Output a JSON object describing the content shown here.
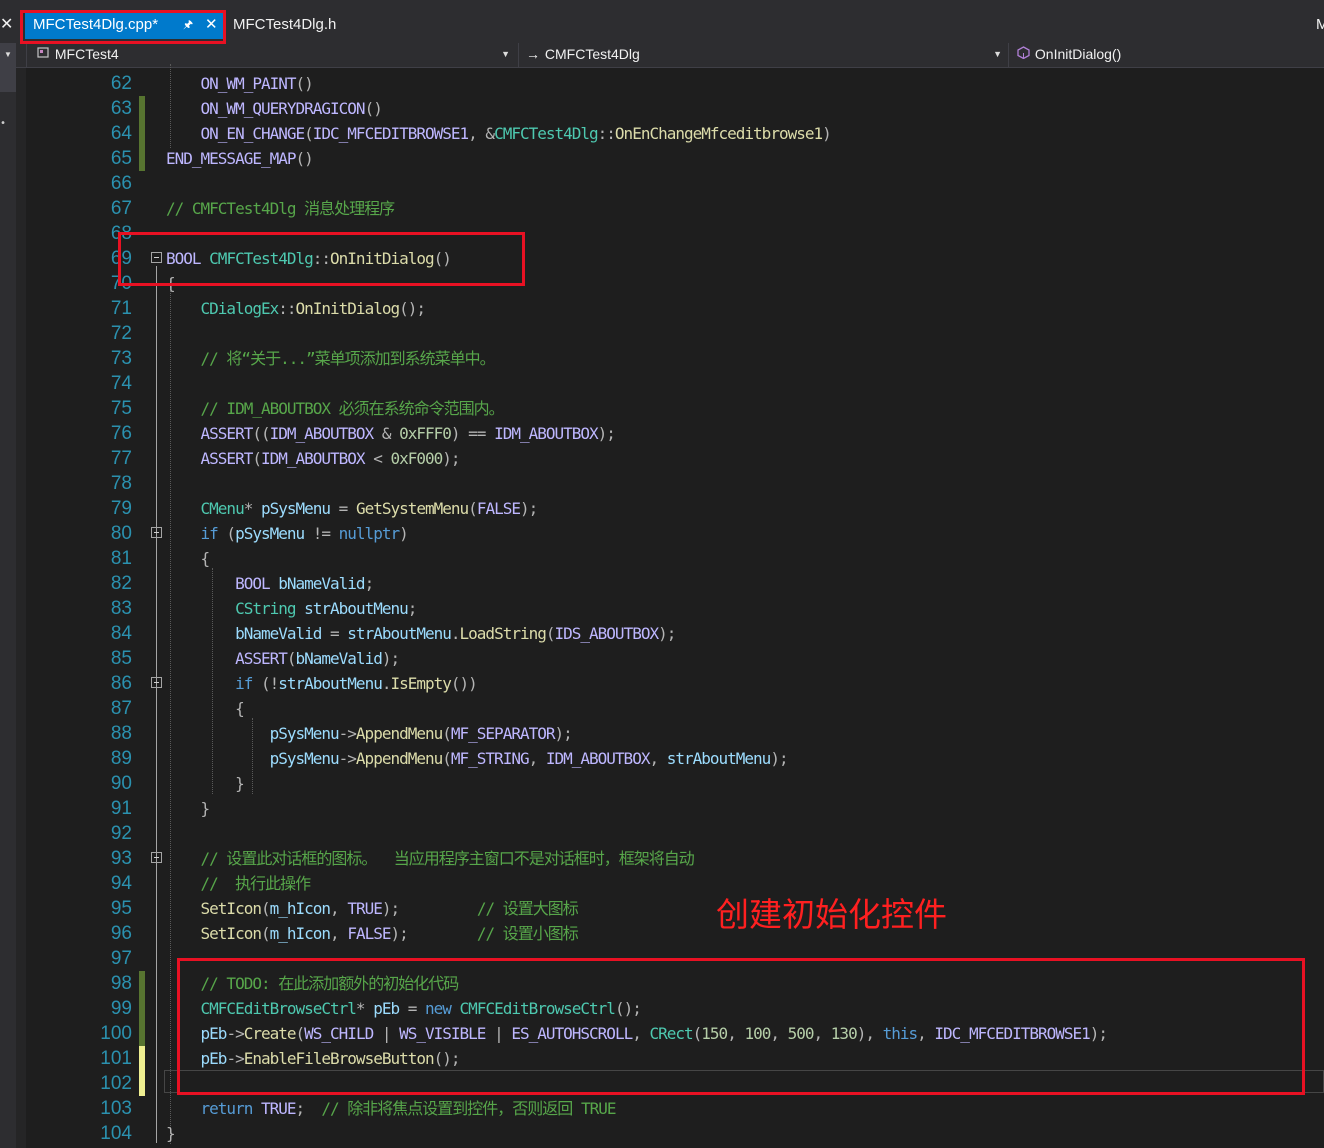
{
  "tabs": {
    "active": {
      "label": "MFCTest4Dlg.cpp*",
      "pin": "🖈",
      "close": "✕"
    },
    "inactive": {
      "label": "MFCTest4Dlg.h"
    },
    "overflow": "M",
    "strip_close": "✕"
  },
  "navbar": {
    "project": "MFCTest4",
    "class": "CMFCTest4Dlg",
    "member": "OnInitDialog()",
    "dropdown_arrow": "▼"
  },
  "icons": {
    "project": "project-icon",
    "class_arrow": "→",
    "method": "method-cube-icon"
  },
  "annotation": "创建初始化控件",
  "colors": {
    "accent": "#007acc",
    "highlight_box": "#e81123",
    "annotation": "#ff2020",
    "line_number": "#2b91af",
    "saved_change": "#577430",
    "unsaved_change": "#efef91"
  },
  "code_lines": [
    {
      "n": "62",
      "toks": [
        [
          "    ",
          "t"
        ],
        [
          "ON_WM_PAINT",
          "m"
        ],
        [
          "()",
          "p"
        ]
      ]
    },
    {
      "n": "63",
      "toks": [
        [
          "    ",
          "t"
        ],
        [
          "ON_WM_QUERYDRAGICON",
          "m"
        ],
        [
          "()",
          "p"
        ]
      ]
    },
    {
      "n": "64",
      "toks": [
        [
          "    ",
          "t"
        ],
        [
          "ON_EN_CHANGE",
          "m"
        ],
        [
          "(",
          "p"
        ],
        [
          "IDC_MFCEDITBROWSE1",
          "m"
        ],
        [
          ", &",
          "p"
        ],
        [
          "CMFCTest4Dlg",
          "y"
        ],
        [
          "::",
          "p"
        ],
        [
          "OnEnChangeMfceditbrowse1",
          "f"
        ],
        [
          ")",
          "p"
        ]
      ]
    },
    {
      "n": "65",
      "toks": [
        [
          "END_MESSAGE_MAP",
          "m"
        ],
        [
          "()",
          "p"
        ]
      ]
    },
    {
      "n": "66",
      "toks": []
    },
    {
      "n": "67",
      "toks": [
        [
          "// CMFCTest4Dlg 消息处理程序",
          "c"
        ]
      ]
    },
    {
      "n": "68",
      "toks": []
    },
    {
      "n": "69",
      "toks": [
        [
          "BOOL",
          "m"
        ],
        [
          " ",
          "t"
        ],
        [
          "CMFCTest4Dlg",
          "y"
        ],
        [
          "::",
          "p"
        ],
        [
          "OnInitDialog",
          "f"
        ],
        [
          "()",
          "p"
        ]
      ]
    },
    {
      "n": "70",
      "toks": [
        [
          "{",
          "p"
        ]
      ]
    },
    {
      "n": "71",
      "toks": [
        [
          "    ",
          "t"
        ],
        [
          "CDialogEx",
          "y"
        ],
        [
          "::",
          "p"
        ],
        [
          "OnInitDialog",
          "f"
        ],
        [
          "();",
          "p"
        ]
      ]
    },
    {
      "n": "72",
      "toks": []
    },
    {
      "n": "73",
      "toks": [
        [
          "    ",
          "t"
        ],
        [
          "// 将“关于...”菜单项添加到系统菜单中。",
          "c"
        ]
      ]
    },
    {
      "n": "74",
      "toks": []
    },
    {
      "n": "75",
      "toks": [
        [
          "    ",
          "t"
        ],
        [
          "// IDM_ABOUTBOX 必须在系统命令范围内。",
          "c"
        ]
      ]
    },
    {
      "n": "76",
      "toks": [
        [
          "    ",
          "t"
        ],
        [
          "ASSERT",
          "m"
        ],
        [
          "((",
          "p"
        ],
        [
          "IDM_ABOUTBOX",
          "m"
        ],
        [
          " & ",
          "p"
        ],
        [
          "0xFFF0",
          "n"
        ],
        [
          ") == ",
          "p"
        ],
        [
          "IDM_ABOUTBOX",
          "m"
        ],
        [
          ");",
          "p"
        ]
      ]
    },
    {
      "n": "77",
      "toks": [
        [
          "    ",
          "t"
        ],
        [
          "ASSERT",
          "m"
        ],
        [
          "(",
          "p"
        ],
        [
          "IDM_ABOUTBOX",
          "m"
        ],
        [
          " < ",
          "p"
        ],
        [
          "0xF000",
          "n"
        ],
        [
          ");",
          "p"
        ]
      ]
    },
    {
      "n": "78",
      "toks": []
    },
    {
      "n": "79",
      "toks": [
        [
          "    ",
          "t"
        ],
        [
          "CMenu",
          "y"
        ],
        [
          "* ",
          "p"
        ],
        [
          "pSysMenu",
          "v"
        ],
        [
          " = ",
          "p"
        ],
        [
          "GetSystemMenu",
          "f"
        ],
        [
          "(",
          "p"
        ],
        [
          "FALSE",
          "m"
        ],
        [
          ");",
          "p"
        ]
      ]
    },
    {
      "n": "80",
      "toks": [
        [
          "    ",
          "t"
        ],
        [
          "if",
          "k"
        ],
        [
          " (",
          "p"
        ],
        [
          "pSysMenu",
          "v"
        ],
        [
          " != ",
          "p"
        ],
        [
          "nullptr",
          "k"
        ],
        [
          ")",
          "p"
        ]
      ]
    },
    {
      "n": "81",
      "toks": [
        [
          "    ",
          "t"
        ],
        [
          "{",
          "p"
        ]
      ]
    },
    {
      "n": "82",
      "toks": [
        [
          "        ",
          "t"
        ],
        [
          "BOOL",
          "m"
        ],
        [
          " ",
          "t"
        ],
        [
          "bNameValid",
          "v"
        ],
        [
          ";",
          "p"
        ]
      ]
    },
    {
      "n": "83",
      "toks": [
        [
          "        ",
          "t"
        ],
        [
          "CString",
          "y"
        ],
        [
          " ",
          "t"
        ],
        [
          "strAboutMenu",
          "v"
        ],
        [
          ";",
          "p"
        ]
      ]
    },
    {
      "n": "84",
      "toks": [
        [
          "        ",
          "t"
        ],
        [
          "bNameValid",
          "v"
        ],
        [
          " = ",
          "p"
        ],
        [
          "strAboutMenu",
          "v"
        ],
        [
          ".",
          "p"
        ],
        [
          "LoadString",
          "f"
        ],
        [
          "(",
          "p"
        ],
        [
          "IDS_ABOUTBOX",
          "m"
        ],
        [
          ");",
          "p"
        ]
      ]
    },
    {
      "n": "85",
      "toks": [
        [
          "        ",
          "t"
        ],
        [
          "ASSERT",
          "m"
        ],
        [
          "(",
          "p"
        ],
        [
          "bNameValid",
          "v"
        ],
        [
          ");",
          "p"
        ]
      ]
    },
    {
      "n": "86",
      "toks": [
        [
          "        ",
          "t"
        ],
        [
          "if",
          "k"
        ],
        [
          " (!",
          "p"
        ],
        [
          "strAboutMenu",
          "v"
        ],
        [
          ".",
          "p"
        ],
        [
          "IsEmpty",
          "f"
        ],
        [
          "())",
          "p"
        ]
      ]
    },
    {
      "n": "87",
      "toks": [
        [
          "        ",
          "t"
        ],
        [
          "{",
          "p"
        ]
      ]
    },
    {
      "n": "88",
      "toks": [
        [
          "            ",
          "t"
        ],
        [
          "pSysMenu",
          "v"
        ],
        [
          "->",
          "p"
        ],
        [
          "AppendMenu",
          "f"
        ],
        [
          "(",
          "p"
        ],
        [
          "MF_SEPARATOR",
          "m"
        ],
        [
          ");",
          "p"
        ]
      ]
    },
    {
      "n": "89",
      "toks": [
        [
          "            ",
          "t"
        ],
        [
          "pSysMenu",
          "v"
        ],
        [
          "->",
          "p"
        ],
        [
          "AppendMenu",
          "f"
        ],
        [
          "(",
          "p"
        ],
        [
          "MF_STRING",
          "m"
        ],
        [
          ", ",
          "p"
        ],
        [
          "IDM_ABOUTBOX",
          "m"
        ],
        [
          ", ",
          "p"
        ],
        [
          "strAboutMenu",
          "v"
        ],
        [
          ");",
          "p"
        ]
      ]
    },
    {
      "n": "90",
      "toks": [
        [
          "        ",
          "t"
        ],
        [
          "}",
          "p"
        ]
      ]
    },
    {
      "n": "91",
      "toks": [
        [
          "    ",
          "t"
        ],
        [
          "}",
          "p"
        ]
      ]
    },
    {
      "n": "92",
      "toks": []
    },
    {
      "n": "93",
      "toks": [
        [
          "    ",
          "t"
        ],
        [
          "// 设置此对话框的图标。  当应用程序主窗口不是对话框时，框架将自动",
          "c"
        ]
      ]
    },
    {
      "n": "94",
      "toks": [
        [
          "    ",
          "t"
        ],
        [
          "//  执行此操作",
          "c"
        ]
      ]
    },
    {
      "n": "95",
      "toks": [
        [
          "    ",
          "t"
        ],
        [
          "SetIcon",
          "f"
        ],
        [
          "(",
          "p"
        ],
        [
          "m_hIcon",
          "v"
        ],
        [
          ", ",
          "p"
        ],
        [
          "TRUE",
          "m"
        ],
        [
          ");         ",
          "p"
        ],
        [
          "// 设置大图标",
          "c"
        ]
      ]
    },
    {
      "n": "96",
      "toks": [
        [
          "    ",
          "t"
        ],
        [
          "SetIcon",
          "f"
        ],
        [
          "(",
          "p"
        ],
        [
          "m_hIcon",
          "v"
        ],
        [
          ", ",
          "p"
        ],
        [
          "FALSE",
          "m"
        ],
        [
          ");        ",
          "p"
        ],
        [
          "// 设置小图标",
          "c"
        ]
      ]
    },
    {
      "n": "97",
      "toks": []
    },
    {
      "n": "98",
      "toks": [
        [
          "    ",
          "t"
        ],
        [
          "// TODO: 在此添加额外的初始化代码",
          "c"
        ]
      ]
    },
    {
      "n": "99",
      "toks": [
        [
          "    ",
          "t"
        ],
        [
          "CMFCEditBrowseCtrl",
          "y"
        ],
        [
          "* ",
          "p"
        ],
        [
          "pEb",
          "v"
        ],
        [
          " = ",
          "p"
        ],
        [
          "new",
          "k"
        ],
        [
          " ",
          "t"
        ],
        [
          "CMFCEditBrowseCtrl",
          "y"
        ],
        [
          "();",
          "p"
        ]
      ]
    },
    {
      "n": "100",
      "toks": [
        [
          "    ",
          "t"
        ],
        [
          "pEb",
          "v"
        ],
        [
          "->",
          "p"
        ],
        [
          "Create",
          "f"
        ],
        [
          "(",
          "p"
        ],
        [
          "WS_CHILD",
          "m"
        ],
        [
          " | ",
          "p"
        ],
        [
          "WS_VISIBLE",
          "m"
        ],
        [
          " | ",
          "p"
        ],
        [
          "ES_AUTOHSCROLL",
          "m"
        ],
        [
          ", ",
          "p"
        ],
        [
          "CRect",
          "y"
        ],
        [
          "(",
          "p"
        ],
        [
          "150",
          "n"
        ],
        [
          ", ",
          "p"
        ],
        [
          "100",
          "n"
        ],
        [
          ", ",
          "p"
        ],
        [
          "500",
          "n"
        ],
        [
          ", ",
          "p"
        ],
        [
          "130",
          "n"
        ],
        [
          "), ",
          "p"
        ],
        [
          "this",
          "k"
        ],
        [
          ", ",
          "p"
        ],
        [
          "IDC_MFCEDITBROWSE1",
          "m"
        ],
        [
          ");",
          "p"
        ]
      ]
    },
    {
      "n": "101",
      "toks": [
        [
          "    ",
          "t"
        ],
        [
          "pEb",
          "v"
        ],
        [
          "->",
          "p"
        ],
        [
          "EnableFileBrowseButton",
          "f"
        ],
        [
          "();",
          "p"
        ]
      ]
    },
    {
      "n": "102",
      "toks": []
    },
    {
      "n": "103",
      "toks": [
        [
          "    ",
          "t"
        ],
        [
          "return",
          "k"
        ],
        [
          " ",
          "t"
        ],
        [
          "TRUE",
          "m"
        ],
        [
          ";  ",
          "p"
        ],
        [
          "// 除非将焦点设置到控件，否则返回 TRUE",
          "c"
        ]
      ]
    },
    {
      "n": "104",
      "toks": [
        [
          "}",
          "p"
        ]
      ]
    }
  ]
}
